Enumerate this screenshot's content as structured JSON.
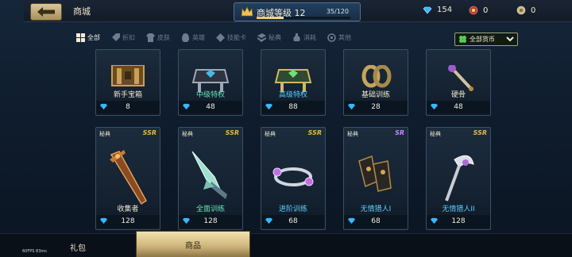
{
  "header": {
    "title": "商城",
    "level_label": "商城等级 12",
    "level_progress": "35/120",
    "level_fill_fraction": 0.29,
    "resources": [
      {
        "icon": "diamond-icon",
        "value": "154"
      },
      {
        "icon": "ruby-icon",
        "value": "0"
      },
      {
        "icon": "coin-icon",
        "value": "0"
      }
    ]
  },
  "filters": [
    {
      "label": "全部",
      "icon": "grid-icon",
      "active": true
    },
    {
      "label": "折扣",
      "icon": "tag-icon",
      "active": false
    },
    {
      "label": "皮肤",
      "icon": "shirt-icon",
      "active": false
    },
    {
      "label": "英雄",
      "icon": "helmet-icon",
      "active": false
    },
    {
      "label": "技能卡",
      "icon": "card-icon",
      "active": false
    },
    {
      "label": "秘典",
      "icon": "book-icon",
      "active": false
    },
    {
      "label": "消耗",
      "icon": "potion-icon",
      "active": false
    },
    {
      "label": "其他",
      "icon": "swirl-icon",
      "active": false
    }
  ],
  "currency_filter": {
    "label": "全部货币"
  },
  "row1": [
    {
      "name": "新手宝箱",
      "price": "8"
    },
    {
      "name": "中级特权",
      "price": "48"
    },
    {
      "name": "高级特权",
      "price": "88"
    },
    {
      "name": "基础训练",
      "price": "28"
    },
    {
      "name": "硬骨",
      "price": "48"
    }
  ],
  "row2": [
    {
      "tag": "秘典",
      "rarity": "SSR",
      "name": "收集者",
      "price": "128"
    },
    {
      "tag": "秘典",
      "rarity": "SSR",
      "name": "全面训练",
      "price": "128"
    },
    {
      "tag": "秘典",
      "rarity": "SSR",
      "name": "进阶训练",
      "price": "68"
    },
    {
      "tag": "秘典",
      "rarity": "SR",
      "name": "无情猎人I",
      "price": "68"
    },
    {
      "tag": "秘典",
      "rarity": "SSR",
      "name": "无情猎人II",
      "price": "128"
    }
  ],
  "bottom_tabs": [
    {
      "label": "礼包"
    },
    {
      "label": "商品"
    }
  ],
  "debug": {
    "fps": "60FPS",
    "ms": "83ms"
  }
}
